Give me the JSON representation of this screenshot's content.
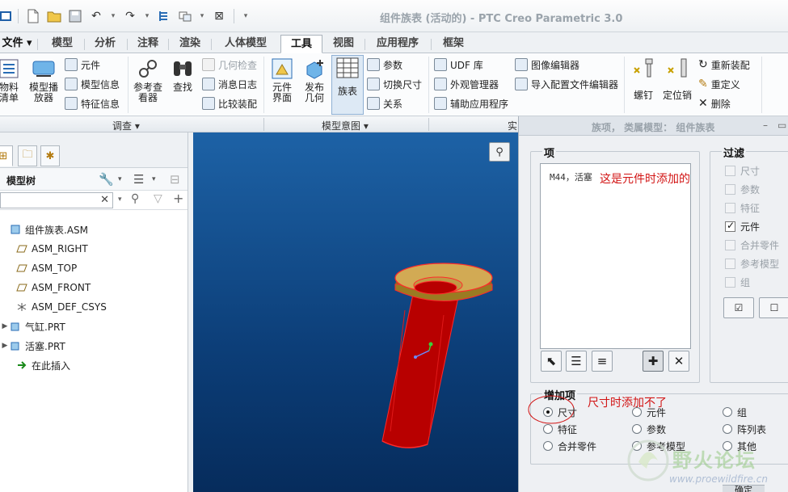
{
  "window": {
    "title": "组件族表 (活动的) - PTC Creo Parametric 3.0"
  },
  "tabs": [
    {
      "label": "文件",
      "dropdown": true
    },
    {
      "label": "模型"
    },
    {
      "label": "分析"
    },
    {
      "label": "注释"
    },
    {
      "label": "渲染"
    },
    {
      "label": "人体模型"
    },
    {
      "label": "工具",
      "active": true
    },
    {
      "label": "视图"
    },
    {
      "label": "应用程序"
    },
    {
      "label": "框架"
    }
  ],
  "ribbon": {
    "bom_label": "物料\n清单",
    "model_player_label": "模型播\n放器",
    "component_label": "元件",
    "model_info_label": "模型信息",
    "feature_info_label": "特征信息",
    "ref_viewer_label": "参考查\n看器",
    "find_label": "查找",
    "geometry_check_label": "几何检查",
    "message_log_label": "消息日志",
    "compare_assembly_label": "比较装配",
    "component_interface_label": "元件\n界面",
    "publish_geometry_label": "发布\n几何",
    "family_table_label": "族表",
    "parameters_label": "参数",
    "switch_dimensions_label": "切换尺寸",
    "relations_label": "关系",
    "udf_library_label": "UDF 库",
    "appearance_manager_label": "外观管理器",
    "aux_application_label": "辅助应用程序",
    "image_editor_label": "图像编辑器",
    "import_config_editor_label": "导入配置文件编辑器",
    "bolt_label": "螺钉",
    "locating_pin_label": "定位销",
    "reassemble_label": "重新装配",
    "redefine_label": "重定义",
    "delete_label": "删除",
    "group_investigate": "调查",
    "group_model_intent": "模型意图",
    "group_cut": "实"
  },
  "model_tree": {
    "header": "模型树",
    "items": [
      {
        "label": "组件族表.ASM",
        "icon": "assembly-icon",
        "expander": ""
      },
      {
        "label": "ASM_RIGHT",
        "icon": "datum-plane-icon",
        "expander": ""
      },
      {
        "label": "ASM_TOP",
        "icon": "datum-plane-icon",
        "expander": ""
      },
      {
        "label": "ASM_FRONT",
        "icon": "datum-plane-icon",
        "expander": ""
      },
      {
        "label": "ASM_DEF_CSYS",
        "icon": "csys-icon",
        "expander": ""
      },
      {
        "label": "气缸.PRT",
        "icon": "part-icon",
        "expander": "▶"
      },
      {
        "label": "活塞.PRT",
        "icon": "part-icon",
        "expander": "▶"
      },
      {
        "label": "在此插入",
        "icon": "insert-arrow-icon",
        "expander": ""
      }
    ]
  },
  "dialog": {
    "title": "族项， 类属模型： 组件族表",
    "items_legend": "项",
    "list_items": [
      "M44，活塞"
    ],
    "annotation_item": "这是元件时添加的",
    "filter_legend": "过滤",
    "filters": [
      {
        "label": "尺寸",
        "checked": false
      },
      {
        "label": "参数",
        "checked": false
      },
      {
        "label": "特征",
        "checked": false
      },
      {
        "label": "元件",
        "checked": true
      },
      {
        "label": "合并零件",
        "checked": false
      },
      {
        "label": "参考模型",
        "checked": false
      },
      {
        "label": "组",
        "checked": false
      }
    ],
    "add_item_legend": "增加项",
    "annotation_dimension": "尺寸时添加不了",
    "add_options": [
      {
        "label": "尺寸",
        "selected": true
      },
      {
        "label": "元件",
        "selected": false
      },
      {
        "label": "组",
        "selected": false
      },
      {
        "label": "特征",
        "selected": false
      },
      {
        "label": "参数",
        "selected": false
      },
      {
        "label": "阵列表",
        "selected": false
      },
      {
        "label": "合并零件",
        "selected": false
      },
      {
        "label": "参考模型",
        "selected": false
      },
      {
        "label": "其他",
        "selected": false
      }
    ],
    "ok_label": "确定"
  },
  "watermark": {
    "title": "野火论坛",
    "url": "www.proewildfire.cn"
  },
  "colors": {
    "viewport_top": "#1d62a6",
    "viewport_bottom": "#062c5c",
    "part_red": "#cc0000",
    "flange_tan": "#c8a34a",
    "annotation_red": "#d21414"
  }
}
